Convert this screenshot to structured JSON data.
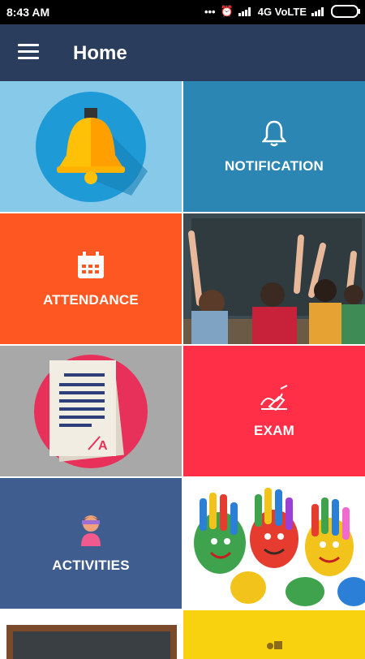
{
  "status_bar": {
    "time": "8:43 AM",
    "network": "4G VoLTE",
    "icons": [
      "more-icon",
      "alarm-icon",
      "signal-icon",
      "battery-icon"
    ]
  },
  "app_bar": {
    "title": "Home",
    "menu_icon": "hamburger-menu-icon"
  },
  "tiles": {
    "bell_image": {
      "icon": "bell-illustration"
    },
    "notification": {
      "label": "NOTIFICATION",
      "icon": "bell-outline-icon"
    },
    "attendance": {
      "label": "ATTENDANCE",
      "icon": "calendar-icon"
    },
    "classroom_image": {
      "icon": "classroom-photo"
    },
    "document_image": {
      "icon": "document-illustration"
    },
    "exam": {
      "label": "EXAM",
      "icon": "writing-hand-icon"
    },
    "activities": {
      "label": "ACTIVITIES",
      "icon": "child-icon"
    },
    "hands_image": {
      "icon": "painted-hands-photo"
    },
    "board_image": {
      "icon": "chalkboard-illustration"
    },
    "yellow_tile": {
      "icon": "people-icon"
    }
  },
  "colors": {
    "app_bar": "#2b3d5c",
    "notification": "#2b86b3",
    "attendance": "#ff5722",
    "exam": "#ff2f48",
    "activities": "#3f5d8e",
    "bell_tile": "#86c9e9",
    "document_tile": "#a8a8a8",
    "yellow_tile": "#f8d20e"
  }
}
